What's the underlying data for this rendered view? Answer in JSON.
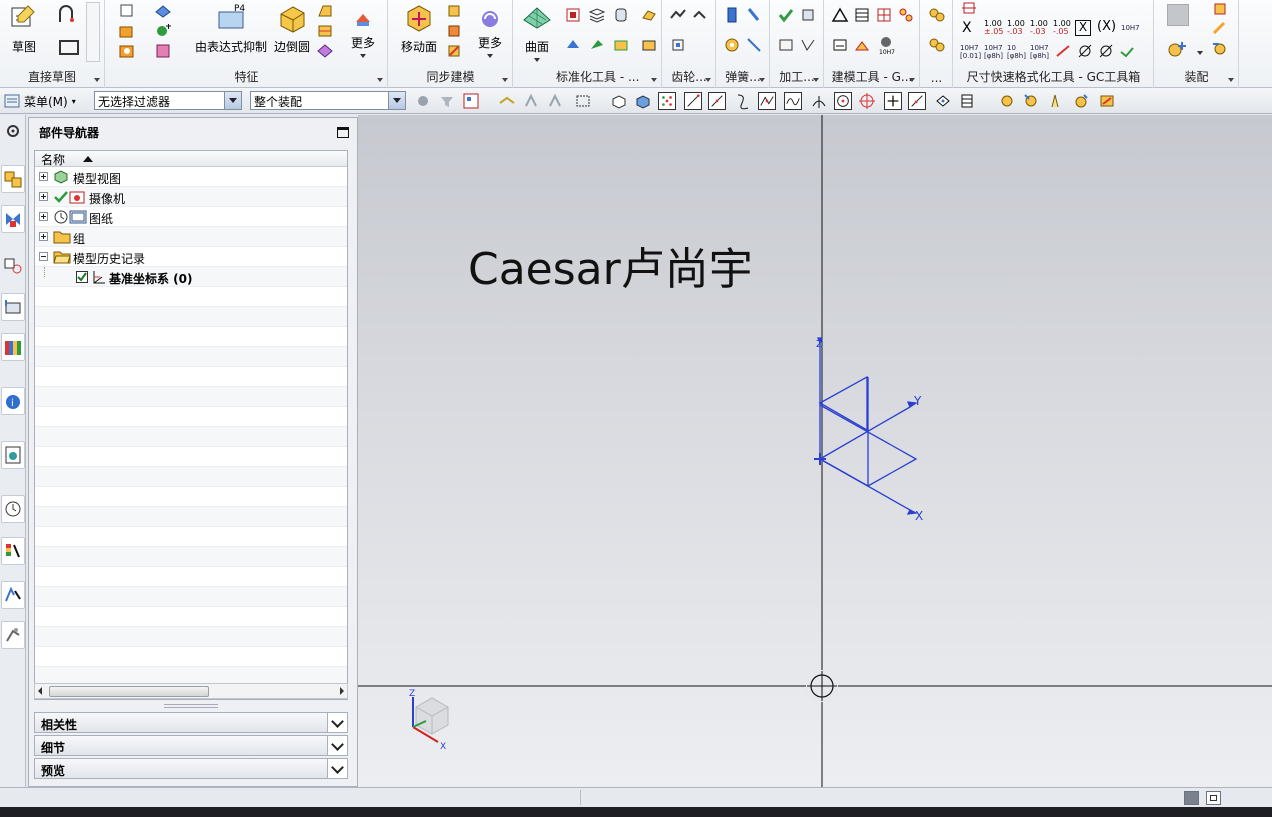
{
  "ribbon": {
    "groups": {
      "direct_sketch": {
        "label": "直接草图",
        "buttons": {
          "sketch": "草图"
        }
      },
      "features": {
        "label": "特征",
        "buttons": {
          "expression_suppress": "由表达式抑制",
          "edge_blend": "边倒圆",
          "more": "更多"
        },
        "badge": "P4"
      },
      "sync_modeling": {
        "label": "同步建模",
        "buttons": {
          "move_face": "移动面",
          "more": "更多"
        }
      },
      "surface": {
        "label": "标准化工具 - ...",
        "buttons": {
          "surface": "曲面"
        }
      },
      "gear": {
        "label": "齿轮..."
      },
      "spring": {
        "label": "弹簧..."
      },
      "machining": {
        "label": "加工..."
      },
      "modeling_tools": {
        "label": "建模工具 - G..."
      },
      "more_dots": {
        "label": "..."
      },
      "dim_format": {
        "label": "尺寸快速格式化工具 - GC工具箱",
        "tol_values": [
          "1.00",
          "1.00",
          "1.00",
          "1.00"
        ],
        "fit_labels": [
          "10H7",
          "10H7",
          "10",
          "10H7"
        ]
      },
      "assembly": {
        "label": "装配"
      }
    }
  },
  "toolbar2": {
    "menu_label": "菜单(M)",
    "filter_value": "无选择过滤器",
    "assembly_scope_value": "整个装配"
  },
  "navigator": {
    "title": "部件导航器",
    "column_header": "名称",
    "items": [
      {
        "label": "模型视图"
      },
      {
        "label": "摄像机"
      },
      {
        "label": "图纸"
      },
      {
        "label": "组"
      },
      {
        "label": "模型历史记录"
      },
      {
        "label": "基准坐标系 (0)"
      }
    ],
    "panels": {
      "dependencies": "相关性",
      "details": "细节",
      "preview": "预览"
    }
  },
  "graphics": {
    "watermark": "Caesar卢尚宇",
    "axis_labels": {
      "x": "X",
      "y": "Y",
      "z": "Z"
    },
    "triad_labels": {
      "x": "X",
      "z": "Z"
    }
  },
  "colors": {
    "axis_blue": "#2a3fd0",
    "triad_red": "#d02020",
    "accent": "#2f6fd0"
  },
  "icons": [
    "gear-icon",
    "part-navigator-icon",
    "assembly-navigator-icon",
    "constraint-navigator-icon",
    "part-family-icon",
    "reuse-library-icon",
    "info-icon",
    "web-browser-icon",
    "history-icon",
    "palette-icon",
    "process-icon",
    "role-icon"
  ]
}
